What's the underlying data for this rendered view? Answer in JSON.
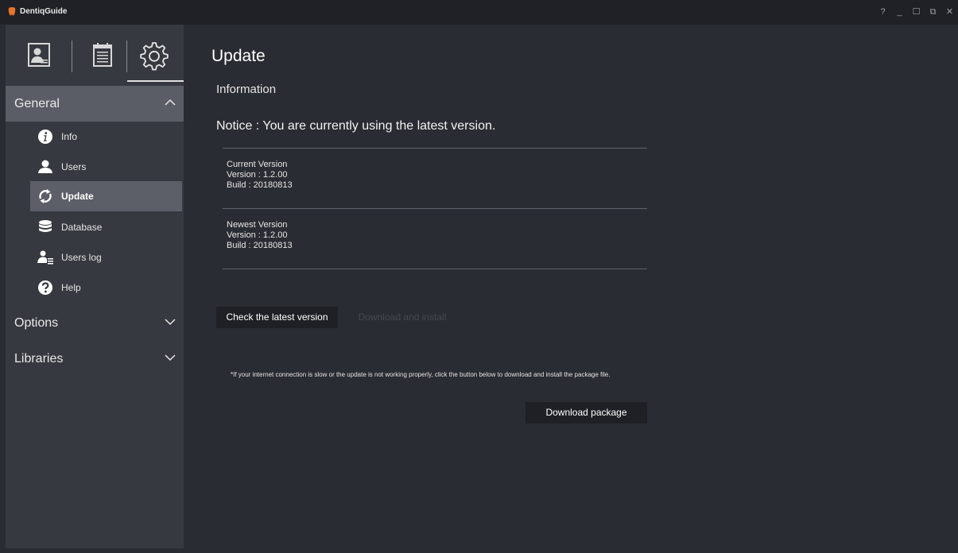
{
  "titlebar": {
    "app_title": "DentiqGuide",
    "controls": [
      "?",
      "_",
      "☐",
      "⧉",
      "✕"
    ]
  },
  "sidebar": {
    "top_icons": [
      "patient-icon",
      "calendar-icon",
      "settings-icon"
    ],
    "active_top_icon": "settings-icon",
    "sections": {
      "general": {
        "label": "General",
        "expanded": true
      },
      "options": {
        "label": "Options",
        "expanded": false
      },
      "libraries": {
        "label": "Libraries",
        "expanded": false
      }
    },
    "items": [
      {
        "label": "Info",
        "icon": "info-icon"
      },
      {
        "label": "Users",
        "icon": "user-icon"
      },
      {
        "label": "Update",
        "icon": "refresh-icon",
        "active": true
      },
      {
        "label": "Database",
        "icon": "database-icon"
      },
      {
        "label": "Users log",
        "icon": "users-log-icon"
      },
      {
        "label": "Help",
        "icon": "help-icon"
      }
    ]
  },
  "main": {
    "title": "Update",
    "section": "Information",
    "notice": "Notice :  You are currently using the latest version.",
    "current": {
      "heading": "Current Version",
      "version": "Version : 1.2.00",
      "build": "Build : 20180813"
    },
    "newest": {
      "heading": "Newest Version",
      "version": "Version : 1.2.00",
      "build": "Build : 20180813"
    },
    "check_button": "Check the latest version",
    "install_button": "Download and install",
    "hint": "*If your internet connection is slow or the update is not working properly, click the button below to download and install the package file.",
    "package_button": "Download package"
  },
  "colors": {
    "background": "#2a2c33",
    "sidebar": "#363940",
    "active_item": "#5c5f67",
    "titlebar": "#1f2126",
    "button": "#1e2025",
    "logo": "#e8742a"
  }
}
